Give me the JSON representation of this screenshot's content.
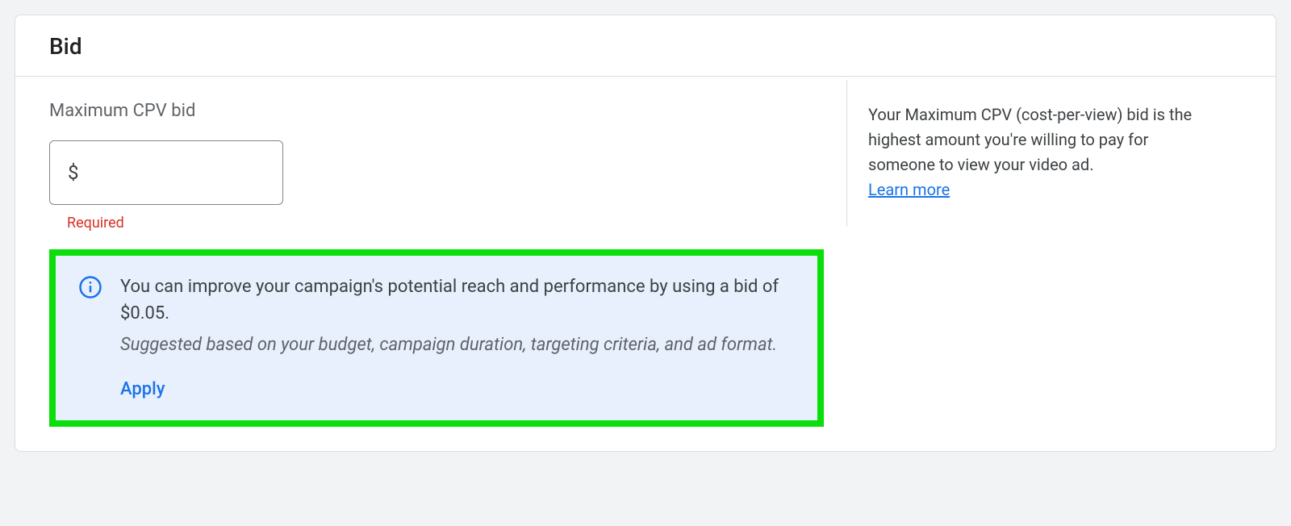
{
  "card": {
    "title": "Bid"
  },
  "bid": {
    "label": "Maximum CPV bid",
    "currency_symbol": "$",
    "value": "",
    "error": "Required"
  },
  "suggestion": {
    "main": "You can improve your campaign's potential reach and performance by using a bid of $0.05.",
    "sub": "Suggested based on your budget, campaign duration, targeting criteria, and ad format.",
    "apply": "Apply"
  },
  "help": {
    "text": "Your Maximum CPV (cost-per-view) bid is the highest amount you're willing to pay for someone to view your video ad.",
    "learn_more": "Learn more"
  }
}
